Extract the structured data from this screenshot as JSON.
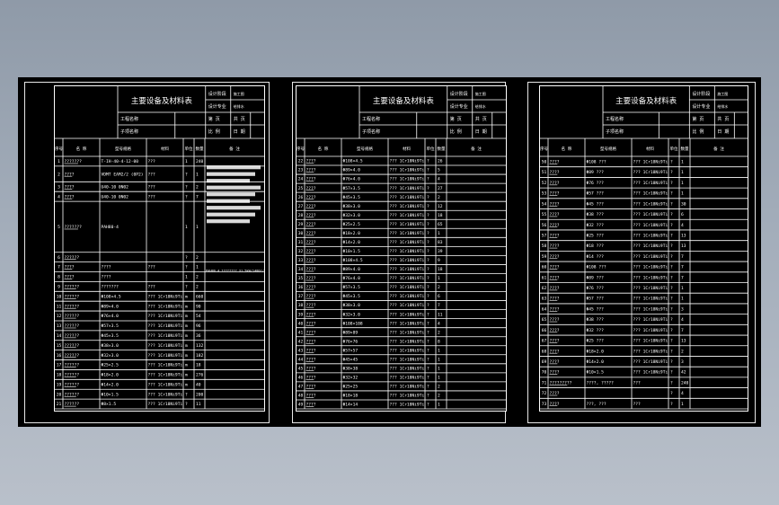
{
  "title": "主要设备及材料表",
  "title_block": {
    "row1": [
      "设计阶段",
      "施工图"
    ],
    "row2": [
      "设计专业",
      "给排水"
    ],
    "row3": [
      "工程名称",
      "第 页",
      "共 页"
    ],
    "row4": [
      "子项名称",
      "比 例",
      "日 期"
    ]
  },
  "columns": [
    "序号",
    "名 称",
    "型号规格",
    "材料",
    "单位",
    "数量",
    "备 注"
  ],
  "sheets": [
    {
      "rows": [
        [
          "1",
          "???????",
          "T-IH-40-4-12-00",
          "???",
          "1",
          "240",
          ""
        ],
        [
          "2",
          "????",
          "VDMT EAM2/2 (0P2)",
          "???",
          "?",
          "1",
          ""
        ],
        [
          "3",
          "????",
          "U40-10 0N02",
          "???",
          "?",
          "2",
          ""
        ],
        [
          "4",
          "????",
          "U40-10 0N02",
          "???",
          "?",
          "7",
          ""
        ],
        [
          "5",
          "???????",
          "PAH80-4",
          "",
          "1",
          "1",
          ""
        ],
        [
          "6",
          "??????",
          "",
          "",
          "?",
          "2",
          ""
        ],
        [
          "7",
          "????",
          "????",
          "???",
          "?",
          "1",
          ""
        ],
        [
          "8",
          "????",
          "????",
          "",
          "1",
          "2",
          ""
        ],
        [
          "9",
          "??????",
          "???????",
          "???",
          "?",
          "2",
          ""
        ],
        [
          "10",
          "??????",
          "Φ108×4.5",
          "??? 1Cr18Ni9Ti",
          "m",
          "660",
          ""
        ],
        [
          "11",
          "??????",
          "Φ89×4.0",
          "??? 1Cr18Ni9Ti",
          "m",
          "90",
          ""
        ],
        [
          "12",
          "??????",
          "Φ76×4.0",
          "??? 1Cr18Ni9Ti",
          "m",
          "54",
          ""
        ],
        [
          "13",
          "??????",
          "Φ57×3.5",
          "??? 1Cr18Ni9Ti",
          "m",
          "96",
          ""
        ],
        [
          "14",
          "??????",
          "Φ45×3.5",
          "??? 1Cr18Ni9Ti",
          "m",
          "36",
          ""
        ],
        [
          "15",
          "??????",
          "Φ38×3.0",
          "??? 1Cr18Ni9Ti",
          "m",
          "132",
          ""
        ],
        [
          "16",
          "??????",
          "Φ32×3.0",
          "??? 1Cr18Ni9Ti",
          "m",
          "182",
          ""
        ],
        [
          "17",
          "??????",
          "Φ25×2.5",
          "??? 1Cr18Ni9Ti",
          "m",
          "18",
          ""
        ],
        [
          "18",
          "??????",
          "Φ18×2.0",
          "??? 1Cr18Ni9Ti",
          "m",
          "276",
          ""
        ],
        [
          "19",
          "??????",
          "Φ14×2.0",
          "??? 1Cr18Ni9Ti",
          "m",
          "40",
          ""
        ],
        [
          "20",
          "??????",
          "Φ10×1.5",
          "??? 1Cr18Ni9Ti",
          "?",
          "200",
          ""
        ],
        [
          "21",
          "??????",
          "Φ8×1.5",
          "??? 1Cr18Ni9Ti",
          "?",
          "11",
          ""
        ]
      ],
      "note": "PAH80-4 ???????? 31.5kW/1480r/min"
    },
    {
      "rows": [
        [
          "22",
          "????",
          "Φ108×4.5",
          "??? 1Cr18Ni9Ti",
          "?",
          "26",
          ""
        ],
        [
          "23",
          "????",
          "Φ89×4.0",
          "??? 1Cr18Ni9Ti",
          "?",
          "5",
          ""
        ],
        [
          "24",
          "????",
          "Φ76×4.0",
          "??? 1Cr18Ni9Ti",
          "?",
          "4",
          ""
        ],
        [
          "25",
          "????",
          "Φ57×3.5",
          "??? 1Cr18Ni9Ti",
          "?",
          "27",
          ""
        ],
        [
          "26",
          "????",
          "Φ45×3.5",
          "??? 1Cr18Ni9Ti",
          "?",
          "2",
          ""
        ],
        [
          "27",
          "????",
          "Φ38×3.0",
          "??? 1Cr18Ni9Ti",
          "?",
          "12",
          ""
        ],
        [
          "28",
          "????",
          "Φ32×3.0",
          "??? 1Cr18Ni9Ti",
          "?",
          "18",
          ""
        ],
        [
          "29",
          "????",
          "Φ25×2.5",
          "??? 1Cr18Ni9Ti",
          "?",
          "65",
          ""
        ],
        [
          "30",
          "????",
          "Φ18×2.0",
          "??? 1Cr18Ni9Ti",
          "?",
          "1",
          ""
        ],
        [
          "31",
          "????",
          "Φ14×2.0",
          "??? 1Cr18Ni9Ti",
          "?",
          "83",
          ""
        ],
        [
          "32",
          "????",
          "Φ10×1.5",
          "??? 1Cr18Ni9Ti",
          "?",
          "39",
          ""
        ],
        [
          "33",
          "????",
          "Φ108×4.5",
          "??? 1Cr18Ni9Ti",
          "?",
          "9",
          ""
        ],
        [
          "34",
          "????",
          "Φ89×4.0",
          "??? 1Cr18Ni9Ti",
          "?",
          "18",
          ""
        ],
        [
          "35",
          "????",
          "Φ76×4.0",
          "??? 1Cr18Ni9Ti",
          "?",
          "1",
          ""
        ],
        [
          "36",
          "????",
          "Φ57×3.5",
          "??? 1Cr18Ni9Ti",
          "?",
          "2",
          ""
        ],
        [
          "37",
          "????",
          "Φ45×3.5",
          "??? 1Cr18Ni9Ti",
          "?",
          "6",
          ""
        ],
        [
          "38",
          "????",
          "Φ38×3.0",
          "??? 1Cr18Ni9Ti",
          "?",
          "7",
          ""
        ],
        [
          "39",
          "????",
          "Φ32×3.0",
          "??? 1Cr18Ni9Ti",
          "?",
          "11",
          ""
        ],
        [
          "40",
          "????",
          "Φ108×108",
          "??? 1Cr18Ni9Ti",
          "?",
          "4",
          ""
        ],
        [
          "41",
          "????",
          "Φ89×89",
          "??? 1Cr18Ni9Ti",
          "?",
          "2",
          ""
        ],
        [
          "42",
          "????",
          "Φ76×76",
          "??? 1Cr18Ni9Ti",
          "?",
          "8",
          ""
        ],
        [
          "43",
          "????",
          "Φ57×57",
          "??? 1Cr18Ni9Ti",
          "?",
          "1",
          ""
        ],
        [
          "44",
          "????",
          "Φ45×45",
          "??? 1Cr18Ni9Ti",
          "?",
          "1",
          ""
        ],
        [
          "45",
          "????",
          "Φ38×38",
          "??? 1Cr18Ni9Ti",
          "?",
          "1",
          ""
        ],
        [
          "46",
          "????",
          "Φ32×32",
          "??? 1Cr18Ni9Ti",
          "?",
          "1",
          ""
        ],
        [
          "47",
          "????",
          "Φ25×25",
          "??? 1Cr18Ni9Ti",
          "?",
          "2",
          ""
        ],
        [
          "48",
          "????",
          "Φ18×18",
          "??? 1Cr18Ni9Ti",
          "?",
          "2",
          ""
        ],
        [
          "49",
          "????",
          "Φ14×14",
          "??? 1Cr18Ni9Ti",
          "?",
          "1",
          ""
        ]
      ]
    },
    {
      "rows": [
        [
          "50",
          "????",
          "Φ108 ???",
          "??? 1Cr18Ni9Ti",
          "?",
          "1",
          ""
        ],
        [
          "51",
          "????",
          "Φ89 ???",
          "??? 1Cr18Ni9Ti",
          "?",
          "1",
          ""
        ],
        [
          "52",
          "????",
          "Φ76 ???",
          "??? 1Cr18Ni9Ti",
          "?",
          "1",
          ""
        ],
        [
          "53",
          "????",
          "Φ57 ???",
          "??? 1Cr18Ni9Ti",
          "?",
          "1",
          ""
        ],
        [
          "54",
          "????",
          "Φ45 ???",
          "??? 1Cr18Ni9Ti",
          "?",
          "30",
          ""
        ],
        [
          "55",
          "????",
          "Φ38 ???",
          "??? 1Cr18Ni9Ti",
          "?",
          "6",
          ""
        ],
        [
          "56",
          "????",
          "Φ32 ???",
          "??? 1Cr18Ni9Ti",
          "?",
          "4",
          ""
        ],
        [
          "57",
          "????",
          "Φ25 ???",
          "??? 1Cr18Ni9Ti",
          "?",
          "13",
          ""
        ],
        [
          "58",
          "????",
          "Φ18 ???",
          "??? 1Cr18Ni9Ti",
          "?",
          "13",
          ""
        ],
        [
          "59",
          "????",
          "Φ14 ???",
          "??? 1Cr18Ni9Ti",
          "?",
          "7",
          ""
        ],
        [
          "60",
          "????",
          "Φ108 ???",
          "??? 1Cr18Ni9Ti",
          "?",
          "7",
          ""
        ],
        [
          "61",
          "????",
          "Φ89 ???",
          "??? 1Cr18Ni9Ti",
          "?",
          "7",
          ""
        ],
        [
          "62",
          "????",
          "Φ76 ???",
          "??? 1Cr18Ni9Ti",
          "?",
          "1",
          ""
        ],
        [
          "63",
          "????",
          "Φ57 ???",
          "??? 1Cr18Ni9Ti",
          "?",
          "1",
          ""
        ],
        [
          "64",
          "????",
          "Φ45 ???",
          "??? 1Cr18Ni9Ti",
          "?",
          "3",
          ""
        ],
        [
          "65",
          "????",
          "Φ38 ???",
          "??? 1Cr18Ni9Ti",
          "?",
          "4",
          ""
        ],
        [
          "66",
          "????",
          "Φ32 ???",
          "??? 1Cr18Ni9Ti",
          "?",
          "7",
          ""
        ],
        [
          "67",
          "????",
          "Φ25 ???",
          "??? 1Cr18Ni9Ti",
          "?",
          "13",
          ""
        ],
        [
          "68",
          "????",
          "Φ18×2.0",
          "??? 1Cr18Ni9Ti",
          "?",
          "2",
          ""
        ],
        [
          "69",
          "????",
          "Φ14×2.0",
          "??? 1Cr18Ni9Ti",
          "?",
          "3",
          ""
        ],
        [
          "70",
          "????",
          "Φ10×1.5",
          "??? 1Cr18Ni9Ti",
          "?",
          "42",
          ""
        ],
        [
          "71",
          "?????????",
          "????, ?????",
          "???",
          "?",
          "240",
          ""
        ],
        [
          "72",
          "????",
          "",
          "",
          "?",
          "4",
          ""
        ],
        [
          "73",
          "????",
          "???, ???",
          "???",
          "?",
          "1",
          ""
        ]
      ]
    }
  ]
}
